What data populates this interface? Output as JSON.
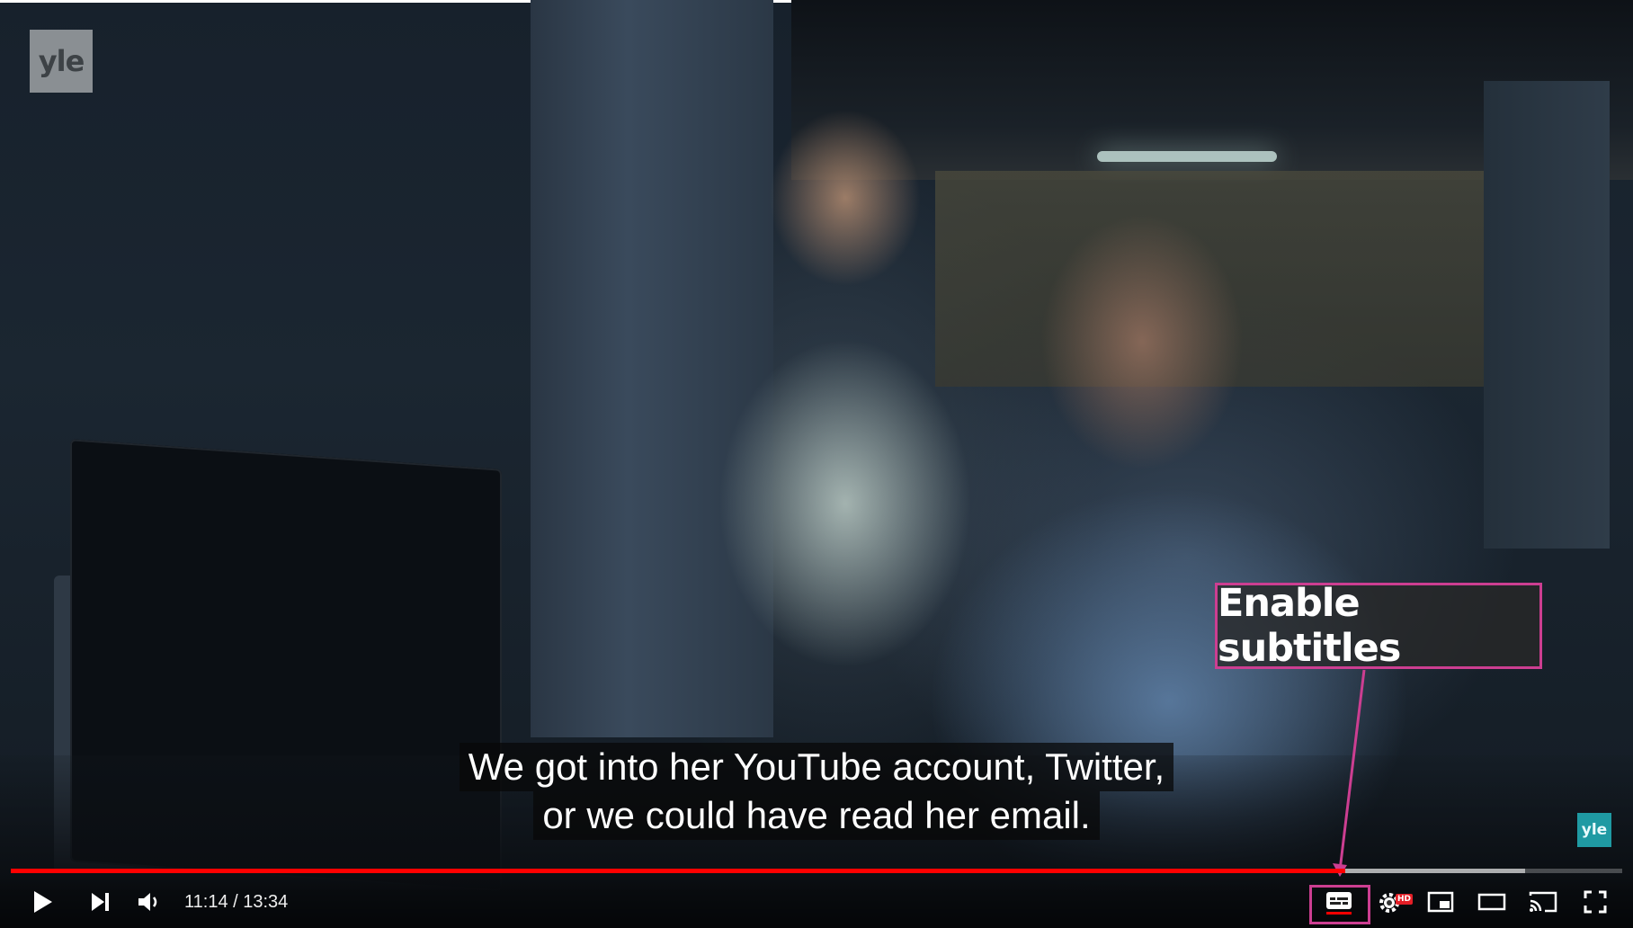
{
  "channel": {
    "logo_text": "yle",
    "watermark_text": "yle"
  },
  "subtitles": [
    "We got into her YouTube account, Twitter,",
    "or we could have read her email."
  ],
  "annotation": {
    "label": "Enable subtitles",
    "color": "#cc3e91"
  },
  "player": {
    "current_time": "11:14",
    "duration": "13:34",
    "time_separator": " / ",
    "progress_fraction": 0.828,
    "buffered_fraction": 0.94,
    "progress_color": "#ff0000",
    "hd_badge": "HD",
    "controls": [
      "play-icon",
      "next-icon",
      "volume-icon",
      "subtitles-cc-icon",
      "settings-gear-icon",
      "miniplayer-icon",
      "theater-mode-icon",
      "cast-icon",
      "fullscreen-icon"
    ]
  }
}
